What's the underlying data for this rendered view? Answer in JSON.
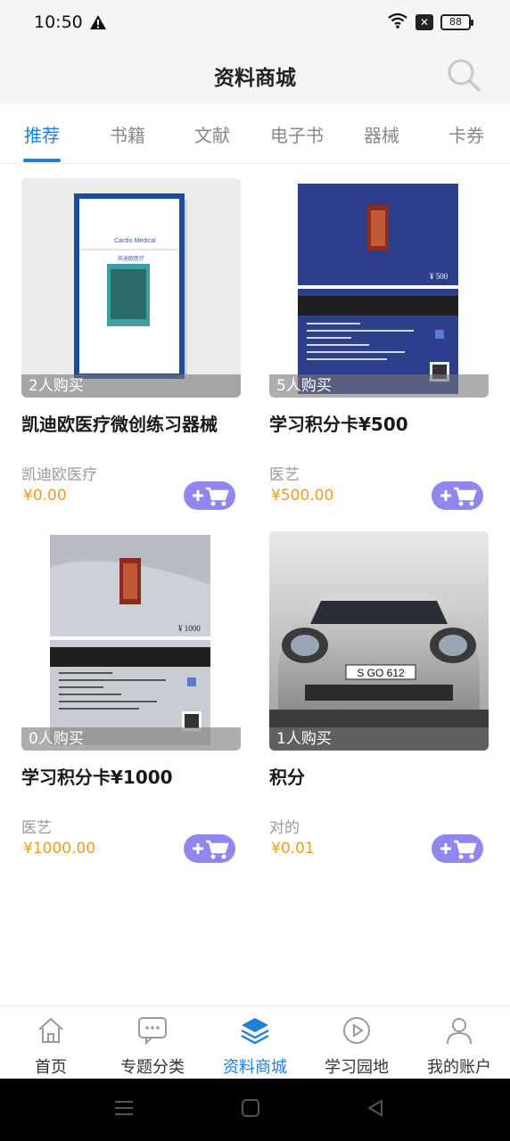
{
  "status_bar": {
    "time": "10:50",
    "battery": "88",
    "sim_icon": "x-icon",
    "wifi_icon": "wifi-icon"
  },
  "header": {
    "title": "资料商城",
    "search_icon": "search-icon"
  },
  "tabs": [
    {
      "label": "推荐",
      "active": true
    },
    {
      "label": "书籍"
    },
    {
      "label": "文献"
    },
    {
      "label": "电子书"
    },
    {
      "label": "器械"
    },
    {
      "label": "卡券"
    }
  ],
  "products": [
    {
      "title": "凯迪欧医疗微创练习器械",
      "brand": "凯迪欧医疗",
      "price": "¥0.00",
      "sold": "2人购买",
      "image": "book-cover"
    },
    {
      "title": "学习积分卡¥500",
      "brand": "医艺",
      "price": "¥500.00",
      "sold": "5人购买",
      "image": "card-blue",
      "card_value": "¥ 500"
    },
    {
      "title": "学习积分卡¥1000",
      "brand": "医艺",
      "price": "¥1000.00",
      "sold": "0人购买",
      "image": "card-grey",
      "card_value": "¥ 1000"
    },
    {
      "title": "积分",
      "brand": "对的",
      "price": "¥0.01",
      "sold": "1人购买",
      "image": "car-photo",
      "plate": "S GO 612"
    }
  ],
  "nav": [
    {
      "label": "首页",
      "icon": "home-icon"
    },
    {
      "label": "专题分类",
      "icon": "chat-icon"
    },
    {
      "label": "资料商城",
      "icon": "layers-icon",
      "active": true
    },
    {
      "label": "学习园地",
      "icon": "play-icon"
    },
    {
      "label": "我的账户",
      "icon": "user-icon"
    }
  ],
  "colors": {
    "accent": "#1f7fd8",
    "price": "#f39a1f",
    "cart": "#8f87ef"
  }
}
